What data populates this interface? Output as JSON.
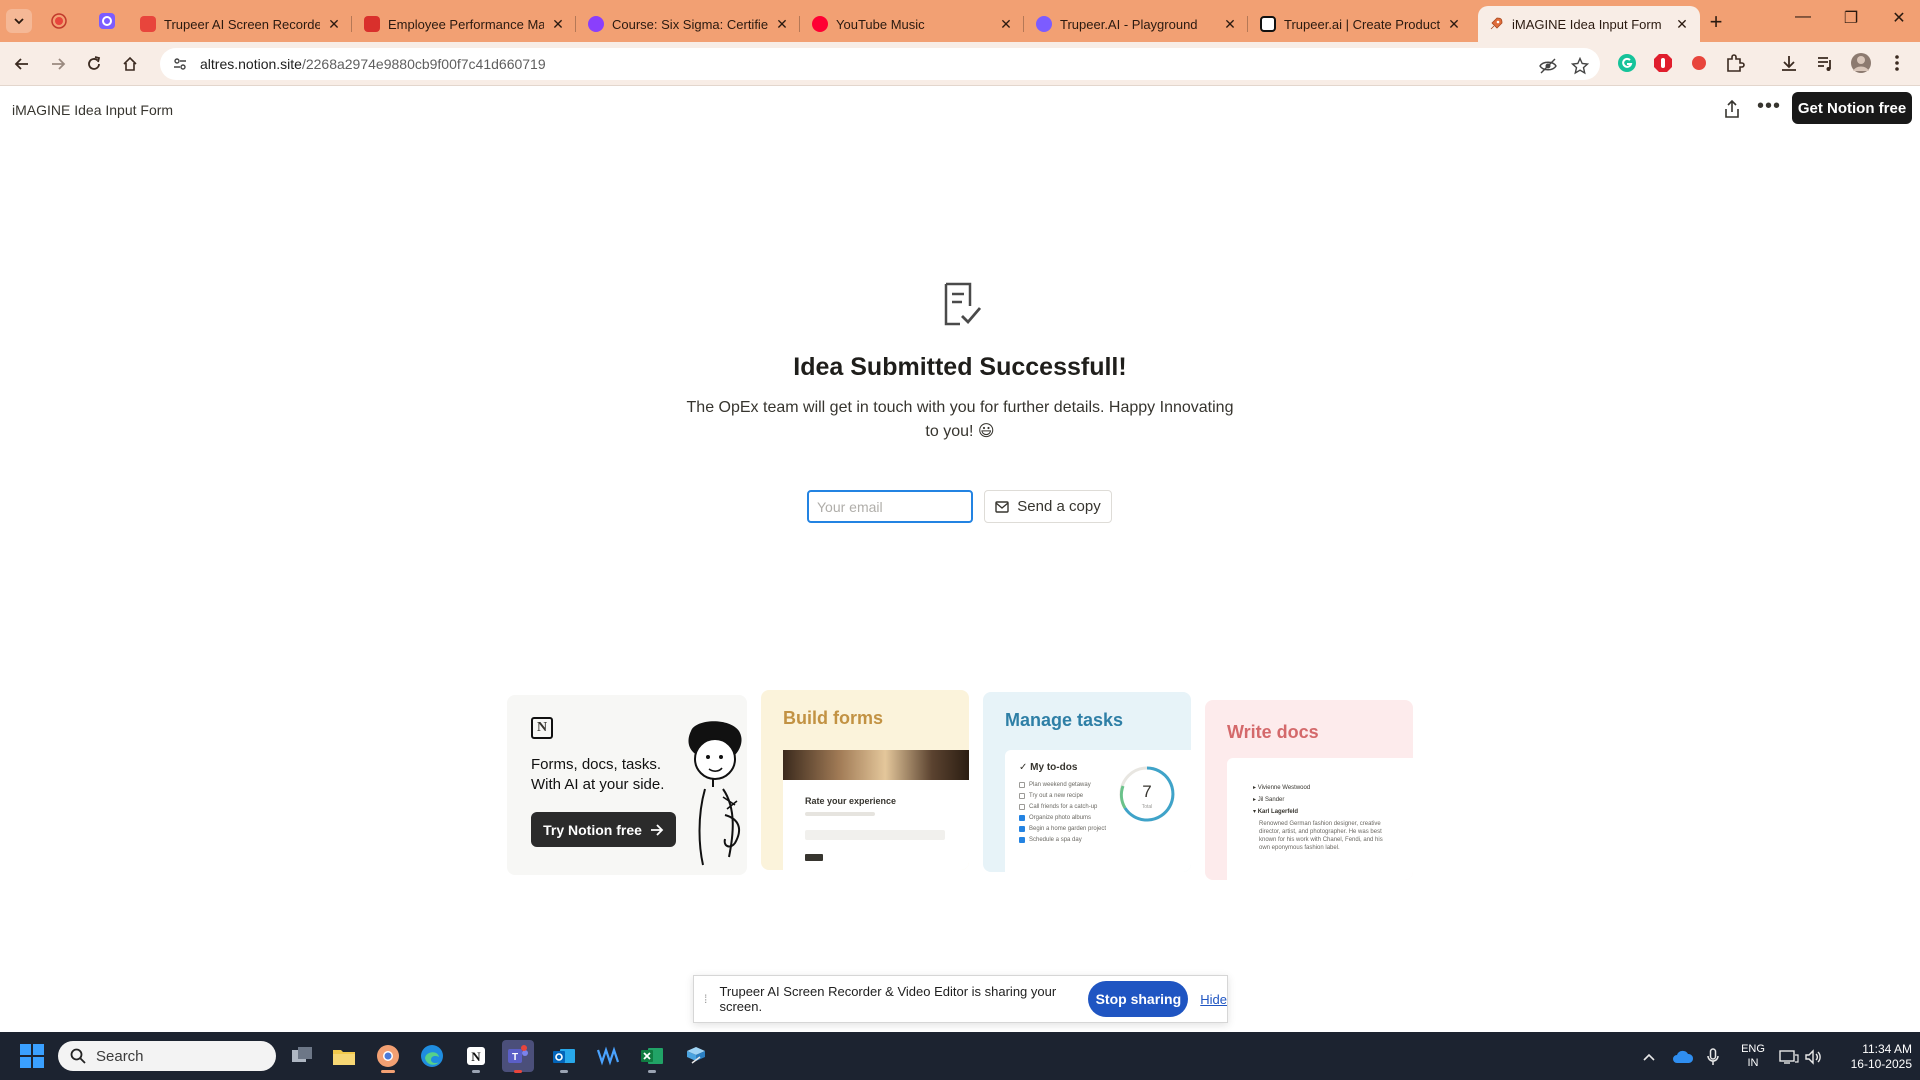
{
  "browser": {
    "tabs": [
      {
        "title": "Trupeer AI Screen Recorder &",
        "favicon_color": "#e8453c"
      },
      {
        "title": "Employee Performance Man",
        "favicon_color": "#d9302c"
      },
      {
        "title": "Course: Six Sigma: Certified L",
        "favicon_color": "#8a3ffc"
      },
      {
        "title": "YouTube Music",
        "favicon_color": "#ff0033"
      },
      {
        "title": "Trupeer.AI - Playground",
        "favicon_color": "#7c5cff"
      },
      {
        "title": "Trupeer.ai | Create Product V",
        "favicon_color": "#111111"
      },
      {
        "title": "iMAGINE Idea Input Form",
        "favicon_color": "#e06c3a",
        "active": true
      }
    ],
    "url_host": "altres.notion.site",
    "url_path": "/2268a2974e9880cb9f00f7c41d660719",
    "chrome_color": "#f2a073"
  },
  "notion": {
    "page_title": "iMAGINE Idea Input Form",
    "get_free_label": "Get Notion free",
    "headline": "Idea Submitted Successfull!",
    "message": "The OpEx team will get in touch with you for further details. Happy Innovating to you! 😃",
    "email_placeholder": "Your email",
    "send_copy_label": "Send a copy",
    "promo": {
      "tagline_line1": "Forms, docs, tasks.",
      "tagline_line2": "With AI at your side.",
      "try_label": "Try Notion free",
      "forms_title": "Build forms",
      "forms_mock_heading": "Rate your experience",
      "tasks_title": "Manage tasks",
      "tasks_mock_heading": "My to-dos",
      "tasks_total": "7",
      "tasks_total_label": "Total",
      "todo_items": [
        {
          "label": "Plan weekend getaway",
          "done": false
        },
        {
          "label": "Try out a new recipe",
          "done": false
        },
        {
          "label": "Call friends for a catch-up",
          "done": false
        },
        {
          "label": "Organize photo albums",
          "done": true
        },
        {
          "label": "Begin a home garden project",
          "done": true
        },
        {
          "label": "Schedule a spa day",
          "done": true
        }
      ],
      "docs_title": "Write docs",
      "doc_items": [
        "Vivienne Westwood",
        "Jil Sander",
        "Karl Lagerfeld"
      ],
      "doc_paragraph": "Renowned German fashion designer, creative director, artist, and photographer. He was best known for his work with Chanel, Fendi, and his own eponymous fashion label."
    }
  },
  "share_bar": {
    "text": "Trupeer AI Screen Recorder & Video Editor is sharing your screen.",
    "stop_label": "Stop sharing",
    "hide_label": "Hide"
  },
  "taskbar": {
    "search_label": "Search",
    "lang_line1": "ENG",
    "lang_line2": "IN",
    "time": "11:34 AM",
    "date": "16-10-2025"
  }
}
